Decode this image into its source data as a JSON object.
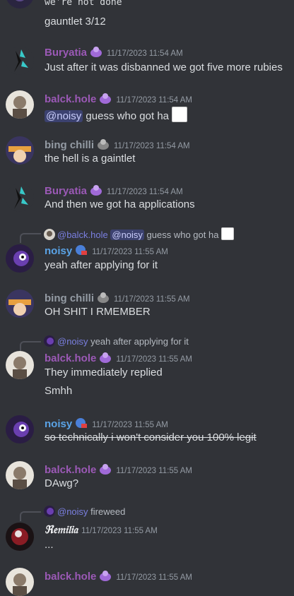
{
  "top": {
    "code_line": " we're not done",
    "line2": "gauntlet 3/12"
  },
  "colors": {
    "bg": "#313338",
    "buryatia": "#9b59b6",
    "balck": "#9b59b6",
    "bing": "#949ba4",
    "noisy": "#5aa3e6",
    "remilia": "#f2f3f5"
  },
  "messages": [
    {
      "user": "Buryatia",
      "time": "11/17/2023 11:54 AM",
      "text": "Just after it was disbanned we got five more rubies"
    },
    {
      "user": "balck.hole",
      "time": "11/17/2023 11:54 AM",
      "mention": "@noisy",
      "text": " guess who got ha"
    },
    {
      "user": "bing chilli",
      "time": "11/17/2023 11:54 AM",
      "text": "the hell is a gaintlet"
    },
    {
      "user": "Buryatia",
      "time": "11/17/2023 11:54 AM",
      "text": "And then we got ha applications"
    },
    {
      "reply_user": "@balck.hole",
      "reply_mention": "@noisy",
      "reply_text": " guess who got ha",
      "user": "noisy",
      "time": "11/17/2023 11:55 AM",
      "text": "yeah after applying for it"
    },
    {
      "user": "bing chilli",
      "time": "11/17/2023 11:55 AM",
      "text": "OH SHIT I RMEMBER"
    },
    {
      "reply_user": "@noisy",
      "reply_text": " yeah after applying for it",
      "user": "balck.hole",
      "time": "11/17/2023 11:55 AM",
      "text": "They immediately replied",
      "text2": "Smhh"
    },
    {
      "user": "noisy",
      "time": "11/17/2023 11:55 AM",
      "text": "so technically i won't consider you 100% legit"
    },
    {
      "user": "balck.hole",
      "time": "11/17/2023 11:55 AM",
      "text": "DAwg?"
    },
    {
      "reply_user": "@noisy",
      "reply_text": " fireweed",
      "user": "ℜ𝔢𝔪𝔦𝔩𝔦𝔞",
      "time": "11/17/2023 11:55 AM",
      "text": "..."
    },
    {
      "user": "balck.hole",
      "time": "11/17/2023 11:55 AM"
    }
  ]
}
